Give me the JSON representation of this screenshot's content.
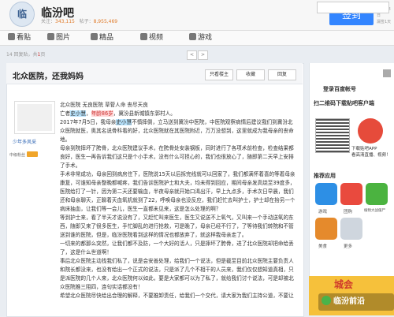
{
  "header": {
    "logo_text": "临",
    "bar_title": "临汾吧",
    "members_label": "关注：",
    "members_count": "343,115",
    "posts_label": "帖子：",
    "posts_count": "8,955,469",
    "signin_label": "签到",
    "signin_date": "07月18日",
    "signin_sub": "漏签1天"
  },
  "nav": {
    "items": [
      {
        "label": "看贴",
        "icon": "post-icon"
      },
      {
        "label": "图片",
        "icon": "picture-icon"
      },
      {
        "label": "精品",
        "icon": "star-icon"
      },
      {
        "label": "视频",
        "icon": "video-icon"
      },
      {
        "label": "游戏",
        "icon": "game-icon"
      }
    ]
  },
  "subbar": {
    "text_prefix": "14 回复贴，共",
    "pages": "1",
    "text_suffix": "页",
    "pager": [
      "<",
      ">",
      "返回"
    ]
  },
  "thread": {
    "title": "北众医院，还我妈妈",
    "btn_owner": "只看楼主",
    "btn_collect": "收藏",
    "btn_reply": "回复"
  },
  "author": {
    "name": "少年多风采",
    "level_label": "中级粉丝"
  },
  "post": {
    "p1": "北众医院 无良医院 草菅人命 丧尽天良",
    "p2_prefix": "亡者",
    "p2_name": "史小慧",
    "p2_age": "年龄86岁",
    "p2_suffix": "，冀汾县新城镇东郭村人。",
    "p3_prefix": "2017年7月5日，我母亲",
    "p3_name": "史小慧",
    "p3_suffix": "不慎摔倒，立马送到冀汾中医院，中医院观察病情后建议我们到冀汾北众医院就医，奥其名说骨科看的好，北众医院就在其医院附近，万万没想到，这里就成为我母亲的丧命地。",
    "p4": "母亲到院摔坏了胯骨，北众医院建议手术，在胯骨处安装钢板，同时进行了各项术前检查，检查结果都良好，医生一再告诉我们这只是个小手术，没有什么可担心的，我们也很放心了，随即第二天早上安排了手术。",
    "p5": "手术非常成功，母亲回到病房住下，医院说15天以后拆完线就可以回家了，我们都满怀着喜的等着母亲康复，可谁知母亲整晚都喊疼，我们告诉医院护士和大夫，均未得到回应，期间母亲发高烧至39度多，医院给打了一针，因为第二天还要输血，半夜母亲就开始口渴出汗，早上九点多，手术次日早晨，我们还和母亲聊天，正聊着天血氧机就到了22，呼唤母亲也没反应，我们赶忙去叫护士，护士却在抬另一个病床抽血，让我们等一会儿，医生一直都未见来，这是怎么处理的啊？",
    "p6": "等到护士来，看了半天才说没有了，又赶忙叫来医生，医生又说送不上氧气，又叫来一个手动送氧的东西，随即又来了很多医生，手忙脚乱的进行抢救，可是晚了，母亲已经不行了，了等待我们转院和不管送到谁的医院，但是，临汾医院看到这样的情况也都放弃了，就这样我母亲走了。",
    "p7": "一切来的都那么突然，让我们都不及防，一个大好的活人，只是摔坏了胯骨，进了北众医院却把命给丢了，这是什么世道啊！",
    "p8": "事后北众医院主动找我们私了，说是会安善处理，给我们一个说法，但是截至目前北众医院主要负责人和院长都没来，也没有给出一个正式的说法，只是派了几个不相干的人员来，我们仅仅想知道真相，只是派医院的几个人来，北众医院何以如此，要是大家都可以为了私了，就给我们讨个说法，可是却被北众医院推三阻四，连句实话都没有！",
    "p9": "希望北众医院尽快给出合理的解释，不要推卸责任，给我们一个交代，请大家为我们主持公道，不要让我的母亲死不瞑目，这样的医院还能让人放心吗！"
  },
  "sidebar": {
    "login_title": "登录百度帐号",
    "qr_title": "扫二维码下载贴吧客户端",
    "qr_text1": "下载贴吧APP",
    "qr_text2": "看高清直播、视频！",
    "rec_title": "推荐应用",
    "apps": [
      {
        "label": "游戏",
        "color": "#2d8fe5"
      },
      {
        "label": "团购",
        "color": "#e94a3e"
      },
      {
        "label": "植物大战僵尸",
        "color": "#4bb340"
      },
      {
        "label": "美食",
        "color": "#e58a2c"
      },
      {
        "label": "更多",
        "color": "#cfd6de"
      }
    ],
    "promo_text": "城会"
  },
  "watermark": {
    "text": "临汾前沿"
  }
}
